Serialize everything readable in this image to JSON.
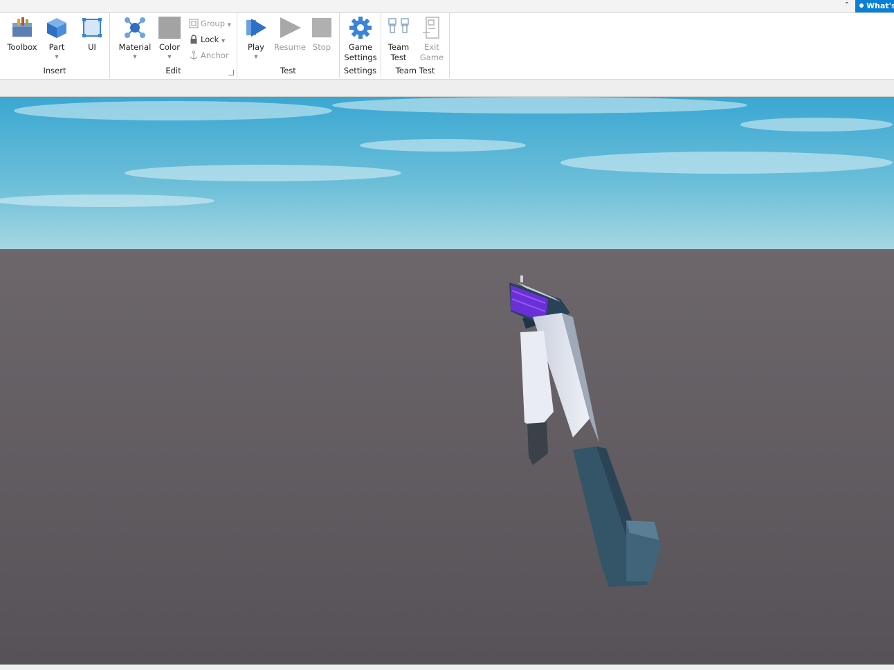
{
  "top_bar": {
    "whats_new_label": "What's",
    "collapse_icon": "chevron-up-icon"
  },
  "ribbon": {
    "insert": {
      "label": "Insert",
      "toolbox": "Toolbox",
      "part": "Part",
      "ui": "UI"
    },
    "edit": {
      "label": "Edit",
      "material": "Material",
      "color": "Color",
      "group": "Group",
      "lock": "Lock",
      "anchor": "Anchor"
    },
    "test": {
      "label": "Test",
      "play": "Play",
      "resume": "Resume",
      "stop": "Stop"
    },
    "settings": {
      "label": "Settings",
      "game_settings_line1": "Game",
      "game_settings_line2": "Settings"
    },
    "team_test": {
      "label": "Team Test",
      "team_test_line1": "Team",
      "team_test_line2": "Test",
      "exit_game_line1": "Exit",
      "exit_game_line2": "Game"
    }
  },
  "viewport": {
    "sky_color": "#6fc0d9",
    "ground_color": "#5f5a5e",
    "model_accent": "#6a2fd6"
  }
}
